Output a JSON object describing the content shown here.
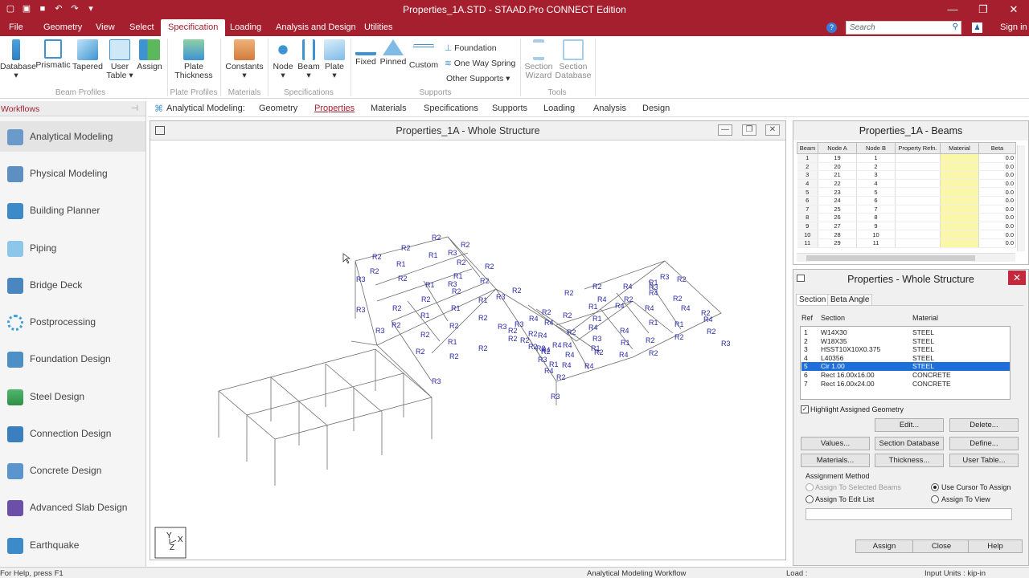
{
  "title_bar": {
    "title": "Properties_1A.STD - STAAD.Pro CONNECT Edition",
    "qat_icons": [
      "new-icon",
      "open-icon",
      "save-icon",
      "undo-icon",
      "redo-icon",
      "customize-icon"
    ]
  },
  "menu": {
    "items": [
      "File",
      "Geometry",
      "View",
      "Select",
      "Specification",
      "Loading",
      "Analysis and Design",
      "Utilities"
    ],
    "active": "Specification",
    "search_placeholder": "Search",
    "sign_in": "Sign in"
  },
  "ribbon": {
    "beam_profiles": {
      "group": "Beam Profiles",
      "buttons": [
        "Database",
        "Prismatic",
        "Tapered",
        "User Table",
        "Assign"
      ]
    },
    "plate_profiles": {
      "group": "Plate Profiles",
      "button": "Plate Thickness"
    },
    "materials": {
      "group": "Materials",
      "button": "Constants"
    },
    "specifications": {
      "group": "Specifications",
      "buttons": [
        "Node",
        "Beam",
        "Plate"
      ]
    },
    "supports": {
      "group": "Supports",
      "buttons": [
        "Fixed",
        "Pinned",
        "Custom"
      ],
      "small": [
        "Foundation",
        "One Way Spring",
        "Other Supports"
      ]
    },
    "tools": {
      "group": "Tools",
      "buttons": [
        "Section Wizard",
        "Section Database"
      ]
    }
  },
  "workflows": {
    "title": "Workflows",
    "items": [
      "Analytical Modeling",
      "Physical Modeling",
      "Building Planner",
      "Piping",
      "Bridge Deck",
      "Postprocessing",
      "Foundation Design",
      "Steel Design",
      "Connection Design",
      "Concrete Design",
      "Advanced Slab Design",
      "Earthquake"
    ],
    "selected": "Analytical Modeling"
  },
  "subnav": {
    "label": "Analytical Modeling:",
    "items": [
      "Geometry",
      "Properties",
      "Materials",
      "Specifications",
      "Supports",
      "Loading",
      "Analysis",
      "Design"
    ],
    "active": "Properties"
  },
  "view_window": {
    "title": "Properties_1A - Whole Structure",
    "axis_labels": [
      "Y",
      "X",
      "Z"
    ]
  },
  "beams_window": {
    "title": "Properties_1A - Beams",
    "columns": [
      "Beam",
      "Node A",
      "Node B",
      "Property Refn.",
      "Material",
      "Beta"
    ],
    "rows": [
      [
        "1",
        "19",
        "1",
        "",
        "",
        "0.0"
      ],
      [
        "2",
        "20",
        "2",
        "",
        "",
        "0.0"
      ],
      [
        "3",
        "21",
        "3",
        "",
        "",
        "0.0"
      ],
      [
        "4",
        "22",
        "4",
        "",
        "",
        "0.0"
      ],
      [
        "5",
        "23",
        "5",
        "",
        "",
        "0.0"
      ],
      [
        "6",
        "24",
        "6",
        "",
        "",
        "0.0"
      ],
      [
        "7",
        "25",
        "7",
        "",
        "",
        "0.0"
      ],
      [
        "8",
        "26",
        "8",
        "",
        "",
        "0.0"
      ],
      [
        "9",
        "27",
        "9",
        "",
        "",
        "0.0"
      ],
      [
        "10",
        "28",
        "10",
        "",
        "",
        "0.0"
      ],
      [
        "11",
        "29",
        "11",
        "",
        "",
        "0.0"
      ]
    ]
  },
  "properties_window": {
    "title": "Properties - Whole Structure",
    "tabs": [
      "Section",
      "Beta Angle"
    ],
    "headers": [
      "Ref",
      "Section",
      "Material"
    ],
    "rows": [
      [
        "1",
        "W14X30",
        "STEEL"
      ],
      [
        "2",
        "W18X35",
        "STEEL"
      ],
      [
        "3",
        "HSST10X10X0.375",
        "STEEL"
      ],
      [
        "4",
        "L40356",
        "STEEL"
      ],
      [
        "5",
        "Cir 1.00",
        "STEEL"
      ],
      [
        "6",
        "Rect 16.00x16.00",
        "CONCRETE"
      ],
      [
        "7",
        "Rect 16.00x24.00",
        "CONCRETE"
      ]
    ],
    "selected_ref": "5",
    "highlight_label": "Highlight Assigned Geometry",
    "buttons": {
      "edit": "Edit...",
      "delete": "Delete...",
      "values": "Values...",
      "section_db": "Section Database",
      "define": "Define...",
      "materials": "Materials...",
      "thickness": "Thickness...",
      "user_table": "User Table...",
      "assign": "Assign",
      "close": "Close",
      "help": "Help"
    },
    "assignment": {
      "title": "Assignment Method",
      "selected_beams": "Assign To Selected Beams",
      "cursor": "Use Cursor To Assign",
      "edit_list": "Assign To Edit List",
      "view": "Assign To View"
    }
  },
  "status": {
    "help": "For Help, press F1",
    "workflow": "Analytical Modeling Workflow",
    "load": "Load :",
    "units": "Input Units : kip-in"
  }
}
